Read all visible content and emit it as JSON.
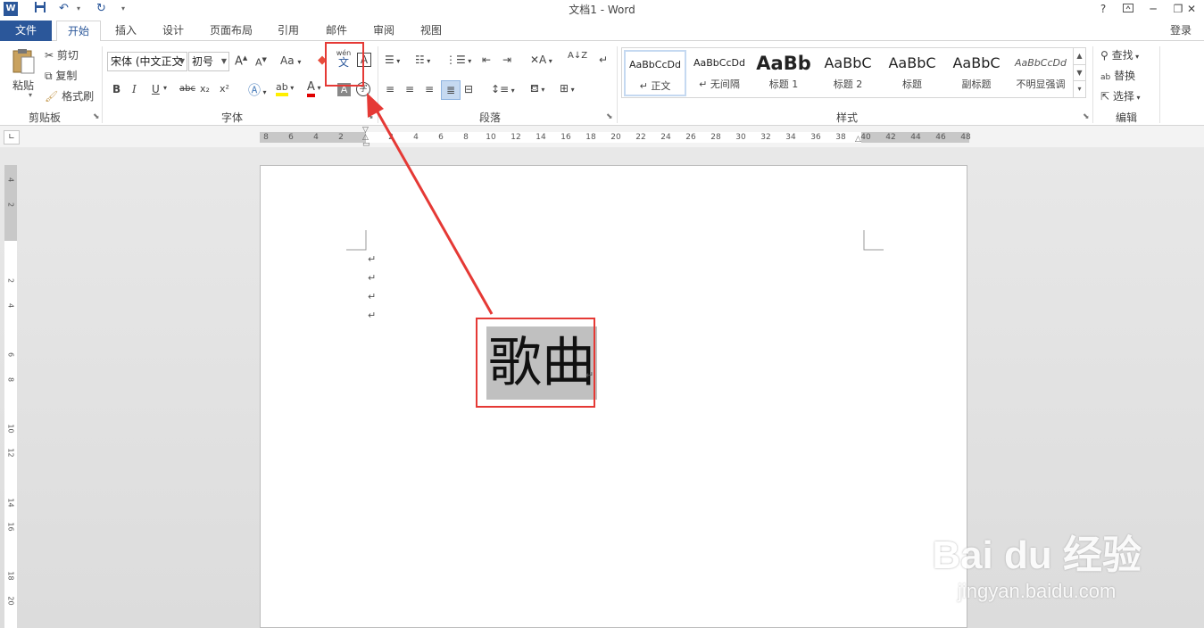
{
  "window": {
    "title": "文档1 - Word",
    "app_icon": "W",
    "help": "?",
    "login": "登录"
  },
  "tabs": {
    "file": "文件",
    "items": [
      "开始",
      "插入",
      "设计",
      "页面布局",
      "引用",
      "邮件",
      "审阅",
      "视图"
    ],
    "active": "开始"
  },
  "clipboard": {
    "paste": "粘贴",
    "cut": "剪切",
    "copy": "复制",
    "format_painter": "格式刷",
    "label": "剪贴板"
  },
  "font": {
    "font_name": "宋体 (中文正文",
    "font_size": "初号",
    "case_label": "Aa",
    "phonetic_top": "wén",
    "phonetic_bottom": "文",
    "border_char": "A",
    "enclose_char": "字",
    "bold": "B",
    "italic": "I",
    "underline": "U",
    "strike": "abc",
    "subscript": "x₂",
    "superscript": "x²",
    "grow": "A",
    "shrink": "A",
    "label": "字体"
  },
  "paragraph": {
    "label": "段落",
    "sort": "A↓Z"
  },
  "styles": {
    "label": "样式",
    "items": [
      {
        "preview": "AaBbCcDd",
        "name": "↵ 正文"
      },
      {
        "preview": "AaBbCcDd",
        "name": "↵ 无间隔"
      },
      {
        "preview": "AaBb",
        "name": "标题 1"
      },
      {
        "preview": "AaBbC",
        "name": "标题 2"
      },
      {
        "preview": "AaBbC",
        "name": "标题"
      },
      {
        "preview": "AaBbC",
        "name": "副标题"
      },
      {
        "preview": "AaBbCcDd",
        "name": "不明显强调"
      }
    ]
  },
  "editing": {
    "find": "查找",
    "replace": "替换",
    "select": "选择",
    "label": "编辑"
  },
  "ruler": {
    "h_ticks": [
      "8",
      "6",
      "4",
      "2",
      "2",
      "4",
      "6",
      "8",
      "10",
      "12",
      "14",
      "16",
      "18",
      "20",
      "22",
      "24",
      "26",
      "28",
      "30",
      "32",
      "34",
      "36",
      "38",
      "40",
      "42",
      "44",
      "46",
      "48"
    ],
    "v_ticks": [
      "4",
      "2",
      "2",
      "4",
      "6",
      "8",
      "10",
      "12",
      "14",
      "16",
      "18",
      "20"
    ]
  },
  "document": {
    "selected_text": "歌曲",
    "paragraph_mark": "↵"
  },
  "watermark": {
    "brand": "Bai du 经验",
    "url": "jingyan.baidu.com"
  },
  "colors": {
    "accent": "#2b579a",
    "annotation": "#e53935"
  }
}
